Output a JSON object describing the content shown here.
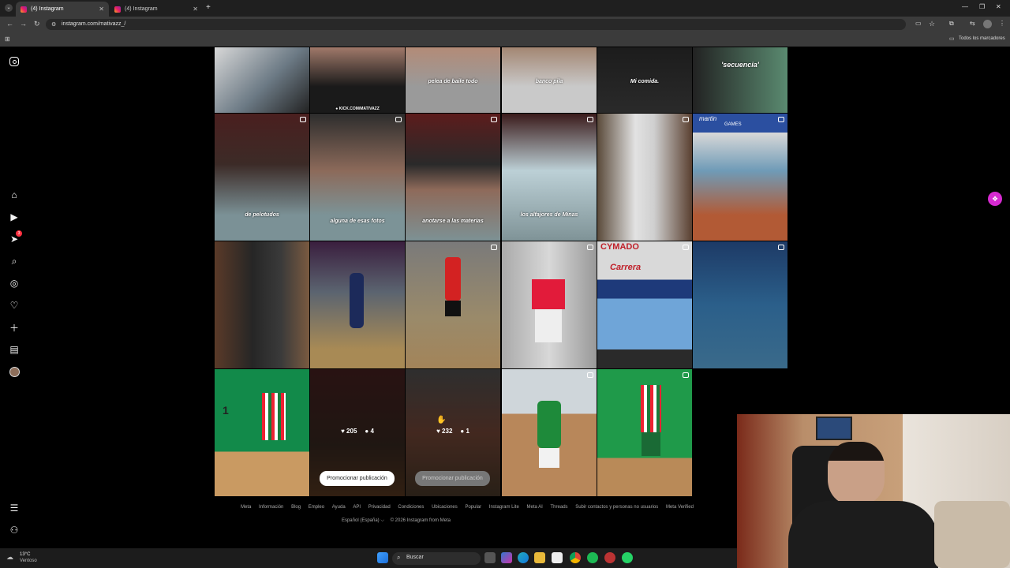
{
  "browser": {
    "tabs": [
      {
        "label": "(4) Instagram",
        "active": true
      },
      {
        "label": "(4) Instagram",
        "active": false
      }
    ],
    "url": "instagram.com/mativazz_/",
    "bookmarks_label": "Todos los marcadores"
  },
  "grid": {
    "row1": [
      {
        "caption": ""
      },
      {
        "caption": "● KICK.COM/MATIVAZZ"
      },
      {
        "caption": "pelea de baile todo"
      },
      {
        "caption": "banco pila"
      },
      {
        "caption": "Mi comida."
      },
      {
        "caption": "'secuencia'"
      }
    ],
    "row2": [
      {
        "caption": "de pelotudos"
      },
      {
        "caption": "alguna de esas fotos"
      },
      {
        "caption": "anotarse a las materias"
      },
      {
        "caption": "los alfajores de Minas"
      },
      {
        "caption": ""
      },
      {
        "caption": ""
      }
    ],
    "row4_stats": [
      {
        "likes": "205",
        "comments": "4",
        "promo": "Promocionar publicación"
      },
      {
        "likes": "232",
        "comments": "1",
        "promo": "Promocionar publicación"
      }
    ],
    "sign_texts": [
      "martin",
      "GAMES",
      "CYMADO",
      "Carrera",
      "1"
    ]
  },
  "footer": {
    "links": [
      "Meta",
      "Información",
      "Blog",
      "Empleo",
      "Ayuda",
      "API",
      "Privacidad",
      "Condiciones",
      "Ubicaciones",
      "Popular",
      "Instagram Lite",
      "Meta AI",
      "Threads",
      "Subir contactos y personas no usuarios",
      "Meta Verified"
    ],
    "language": "Español (España) ⌵",
    "copyright": "© 2026 Instagram from Meta"
  },
  "taskbar": {
    "weather_temp": "13°C",
    "weather_desc": "Ventoso",
    "search_placeholder": "Buscar"
  },
  "sidebar": {
    "notifications_badge": "3"
  },
  "colors": {
    "badge": "#ff3040",
    "float_button": "#d62ad1"
  }
}
